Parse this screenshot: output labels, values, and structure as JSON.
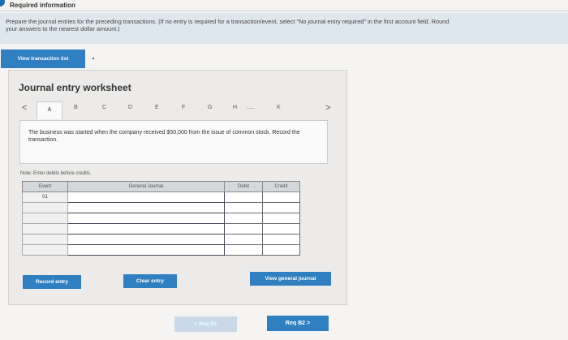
{
  "header": {
    "title": "Required information"
  },
  "instructions": {
    "text": "Prepare the journal entries for the preceding transactions. (If no entry is required for a transaction/event, select \"No journal entry required\" in the first account field. Round your answers to the nearest dollar amount.)"
  },
  "buttons": {
    "view_transaction_list": "View transaction list",
    "record_entry": "Record entry",
    "clear_entry": "Clear entry",
    "view_general_journal": "View general journal"
  },
  "worksheet": {
    "title": "Journal entry worksheet",
    "tab_prev": "<",
    "tab_next": ">",
    "tabs": [
      "A",
      "B",
      "C",
      "D",
      "E",
      "F",
      "G",
      "H",
      ".....",
      "K"
    ],
    "description": "The business was started when the company received $50,000 from the issue of common stock. Record the transaction.",
    "note": "Note: Enter debits before credits."
  },
  "table": {
    "headers": [
      "Event",
      "General Journal",
      "Debit",
      "Credit"
    ],
    "rows": [
      {
        "event": "01",
        "account": "",
        "debit": "",
        "credit": ""
      },
      {
        "event": "",
        "account": "",
        "debit": "",
        "credit": ""
      },
      {
        "event": "",
        "account": "",
        "debit": "",
        "credit": ""
      },
      {
        "event": "",
        "account": "",
        "debit": "",
        "credit": ""
      },
      {
        "event": "",
        "account": "",
        "debit": "",
        "credit": ""
      },
      {
        "event": "",
        "account": "",
        "debit": "",
        "credit": ""
      }
    ]
  },
  "navigation": {
    "prev_label": "< Req B1",
    "next_label": "Req B2 >"
  },
  "colors": {
    "accent": "#2f7fc1",
    "instruction_bg": "#dfe7ee",
    "disabled_button": "#c9d9e8"
  }
}
